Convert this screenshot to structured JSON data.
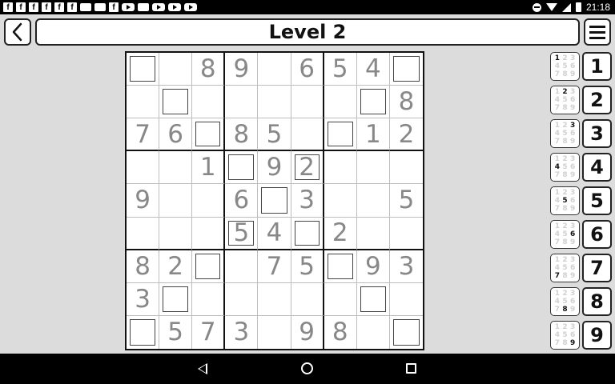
{
  "status_bar": {
    "time": "21:18",
    "notification_icons": [
      "facebook-icon",
      "facebook-icon",
      "facebook-icon",
      "facebook-icon",
      "facebook-icon",
      "facebook-icon",
      "image-icon",
      "mail-icon",
      "facebook-icon",
      "play-store-icon",
      "android-icon",
      "youtube-icon",
      "youtube-icon",
      "youtube-icon"
    ]
  },
  "header": {
    "title": "Level 2"
  },
  "board": [
    [
      "",
      "",
      "8",
      "9",
      "",
      "6",
      "5",
      "4",
      ""
    ],
    [
      "",
      "",
      "",
      "",
      "",
      "",
      "",
      "",
      "8"
    ],
    [
      "7",
      "6",
      "",
      "8",
      "5",
      "",
      "",
      "1",
      "2"
    ],
    [
      "",
      "",
      "1",
      "",
      "9",
      "2",
      "",
      "",
      ""
    ],
    [
      "9",
      "",
      "",
      "6",
      "",
      "3",
      "",
      "",
      "5"
    ],
    [
      "",
      "",
      "",
      "5",
      "4",
      "",
      "2",
      "",
      ""
    ],
    [
      "8",
      "2",
      "",
      "",
      "7",
      "5",
      "",
      "9",
      "3"
    ],
    [
      "3",
      "",
      "",
      "",
      "",
      "",
      "",
      "",
      ""
    ],
    [
      "",
      "5",
      "7",
      "3",
      "",
      "9",
      "8",
      "",
      ""
    ]
  ],
  "number_buttons": [
    "1",
    "2",
    "3",
    "4",
    "5",
    "6",
    "7",
    "8",
    "9"
  ],
  "note_digits": [
    "1",
    "2",
    "3",
    "4",
    "5",
    "6",
    "7",
    "8",
    "9"
  ]
}
